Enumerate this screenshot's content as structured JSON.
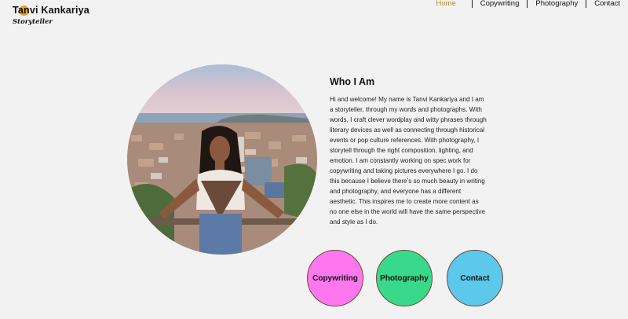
{
  "brand": {
    "name": "Tanvi Kankariya",
    "tagline": "Storyteller"
  },
  "nav": {
    "items": [
      {
        "label": "Home"
      },
      {
        "label": "Copywriting"
      },
      {
        "label": "Photography"
      },
      {
        "label": "Contact"
      }
    ]
  },
  "about": {
    "heading": "Who I Am",
    "body": "Hi and welcome! My name is Tanvi Kankariya and I am a storyteller, through my words and photographs. With words, I craft clever wordplay and witty phrases through literary devices as well as connecting through historical events or pop culture references. With photography, I storytell through the right composition, lighting, and emotion. I am constantly working on spec work for copywriting and taking pictures everywhere I go. I do this because I believe there’s so much beauty in writing and photography, and everyone has a different aesthetic. This inspires me to create more content as no one else in the world will have the same perspective and style as I do."
  },
  "cta": {
    "copywriting": "Copywriting",
    "photography": "Photography",
    "contact": "Contact"
  },
  "colors": {
    "accent": "#b78a2e",
    "copywriting_button": "#ff77ee",
    "photography_button": "#38d98a",
    "contact_button": "#5bc8ec"
  }
}
